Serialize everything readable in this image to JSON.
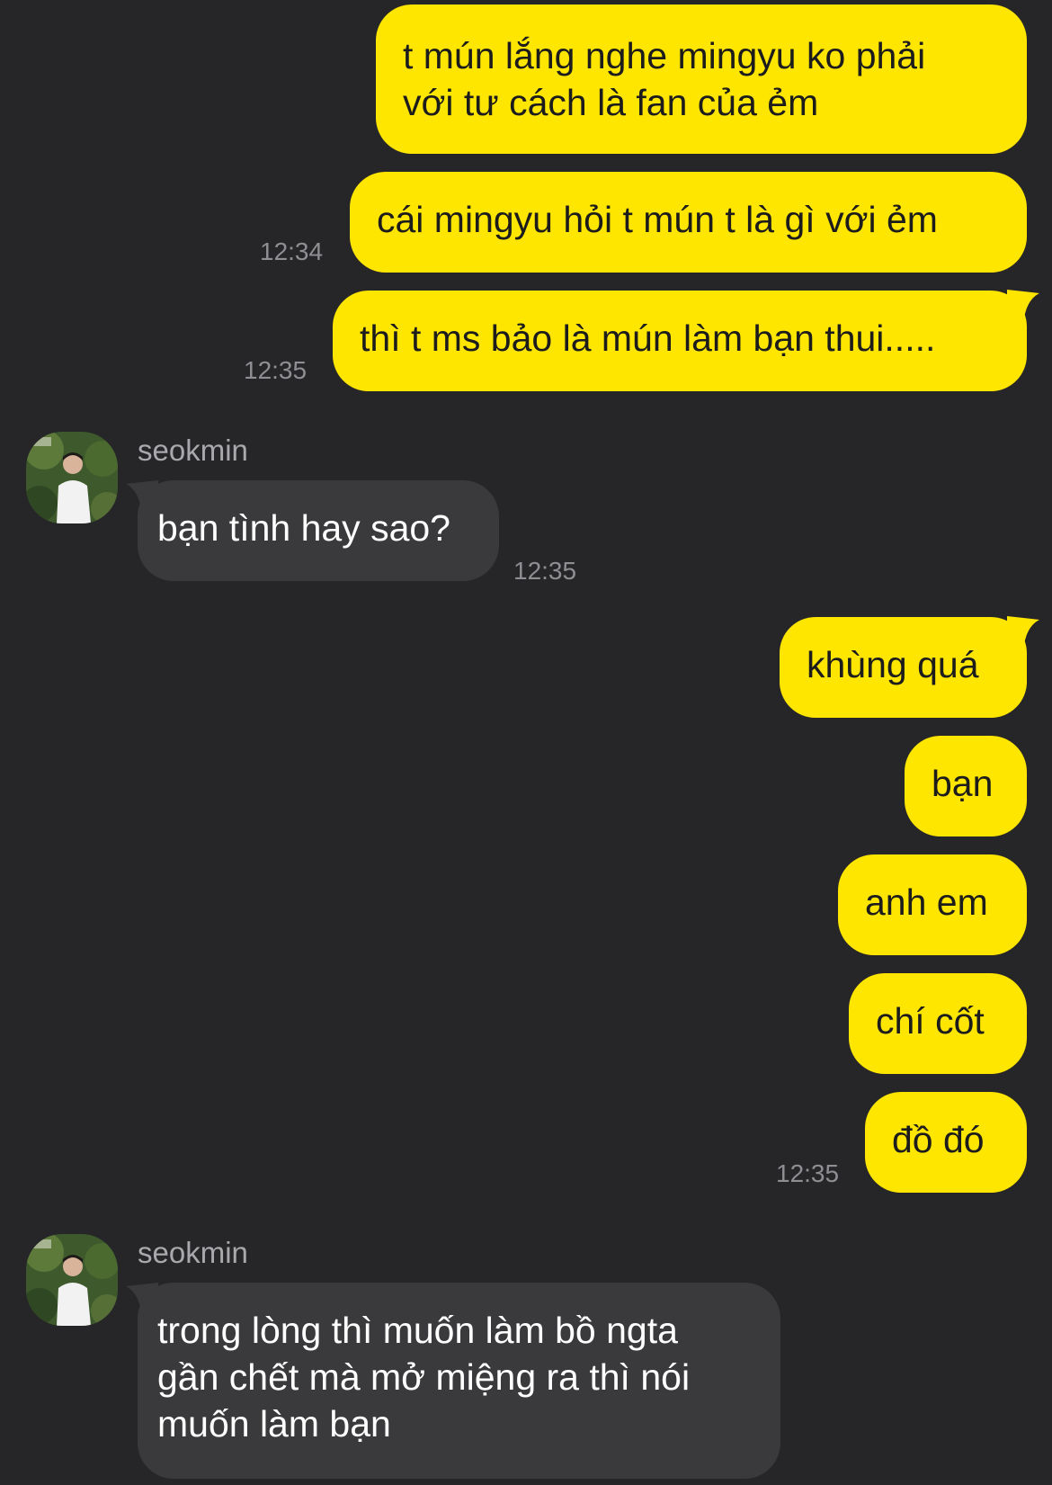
{
  "colors": {
    "background": "#262628",
    "outgoing_bubble": "#FFE600",
    "incoming_bubble": "#3a3a3c",
    "timestamp": "#8e8e93",
    "sender_name": "#a9a9ad"
  },
  "messages": [
    {
      "dir": "out",
      "text": "t mún lắng nghe mingyu ko phải\nvới tư cách là fan của ẻm"
    },
    {
      "dir": "out",
      "text": "cái mingyu hỏi t mún t là gì với ẻm",
      "time": "12:34"
    },
    {
      "dir": "out",
      "text": "thì t ms bảo là mún làm bạn thui.....",
      "time": "12:35"
    },
    {
      "dir": "in",
      "sender": "seokmin",
      "text": "bạn tình hay sao?",
      "time": "12:35",
      "avatar": "avatar-photo"
    },
    {
      "dir": "out",
      "text": "khùng quá"
    },
    {
      "dir": "out",
      "text": "bạn"
    },
    {
      "dir": "out",
      "text": "anh em"
    },
    {
      "dir": "out",
      "text": "chí cốt"
    },
    {
      "dir": "out",
      "text": "đồ đó",
      "time": "12:35"
    },
    {
      "dir": "in",
      "sender": "seokmin",
      "text": "trong lòng thì muốn làm bồ ngta\ngần chết mà mở miệng ra thì nói\nmuốn làm bạn",
      "avatar": "avatar-photo"
    }
  ]
}
